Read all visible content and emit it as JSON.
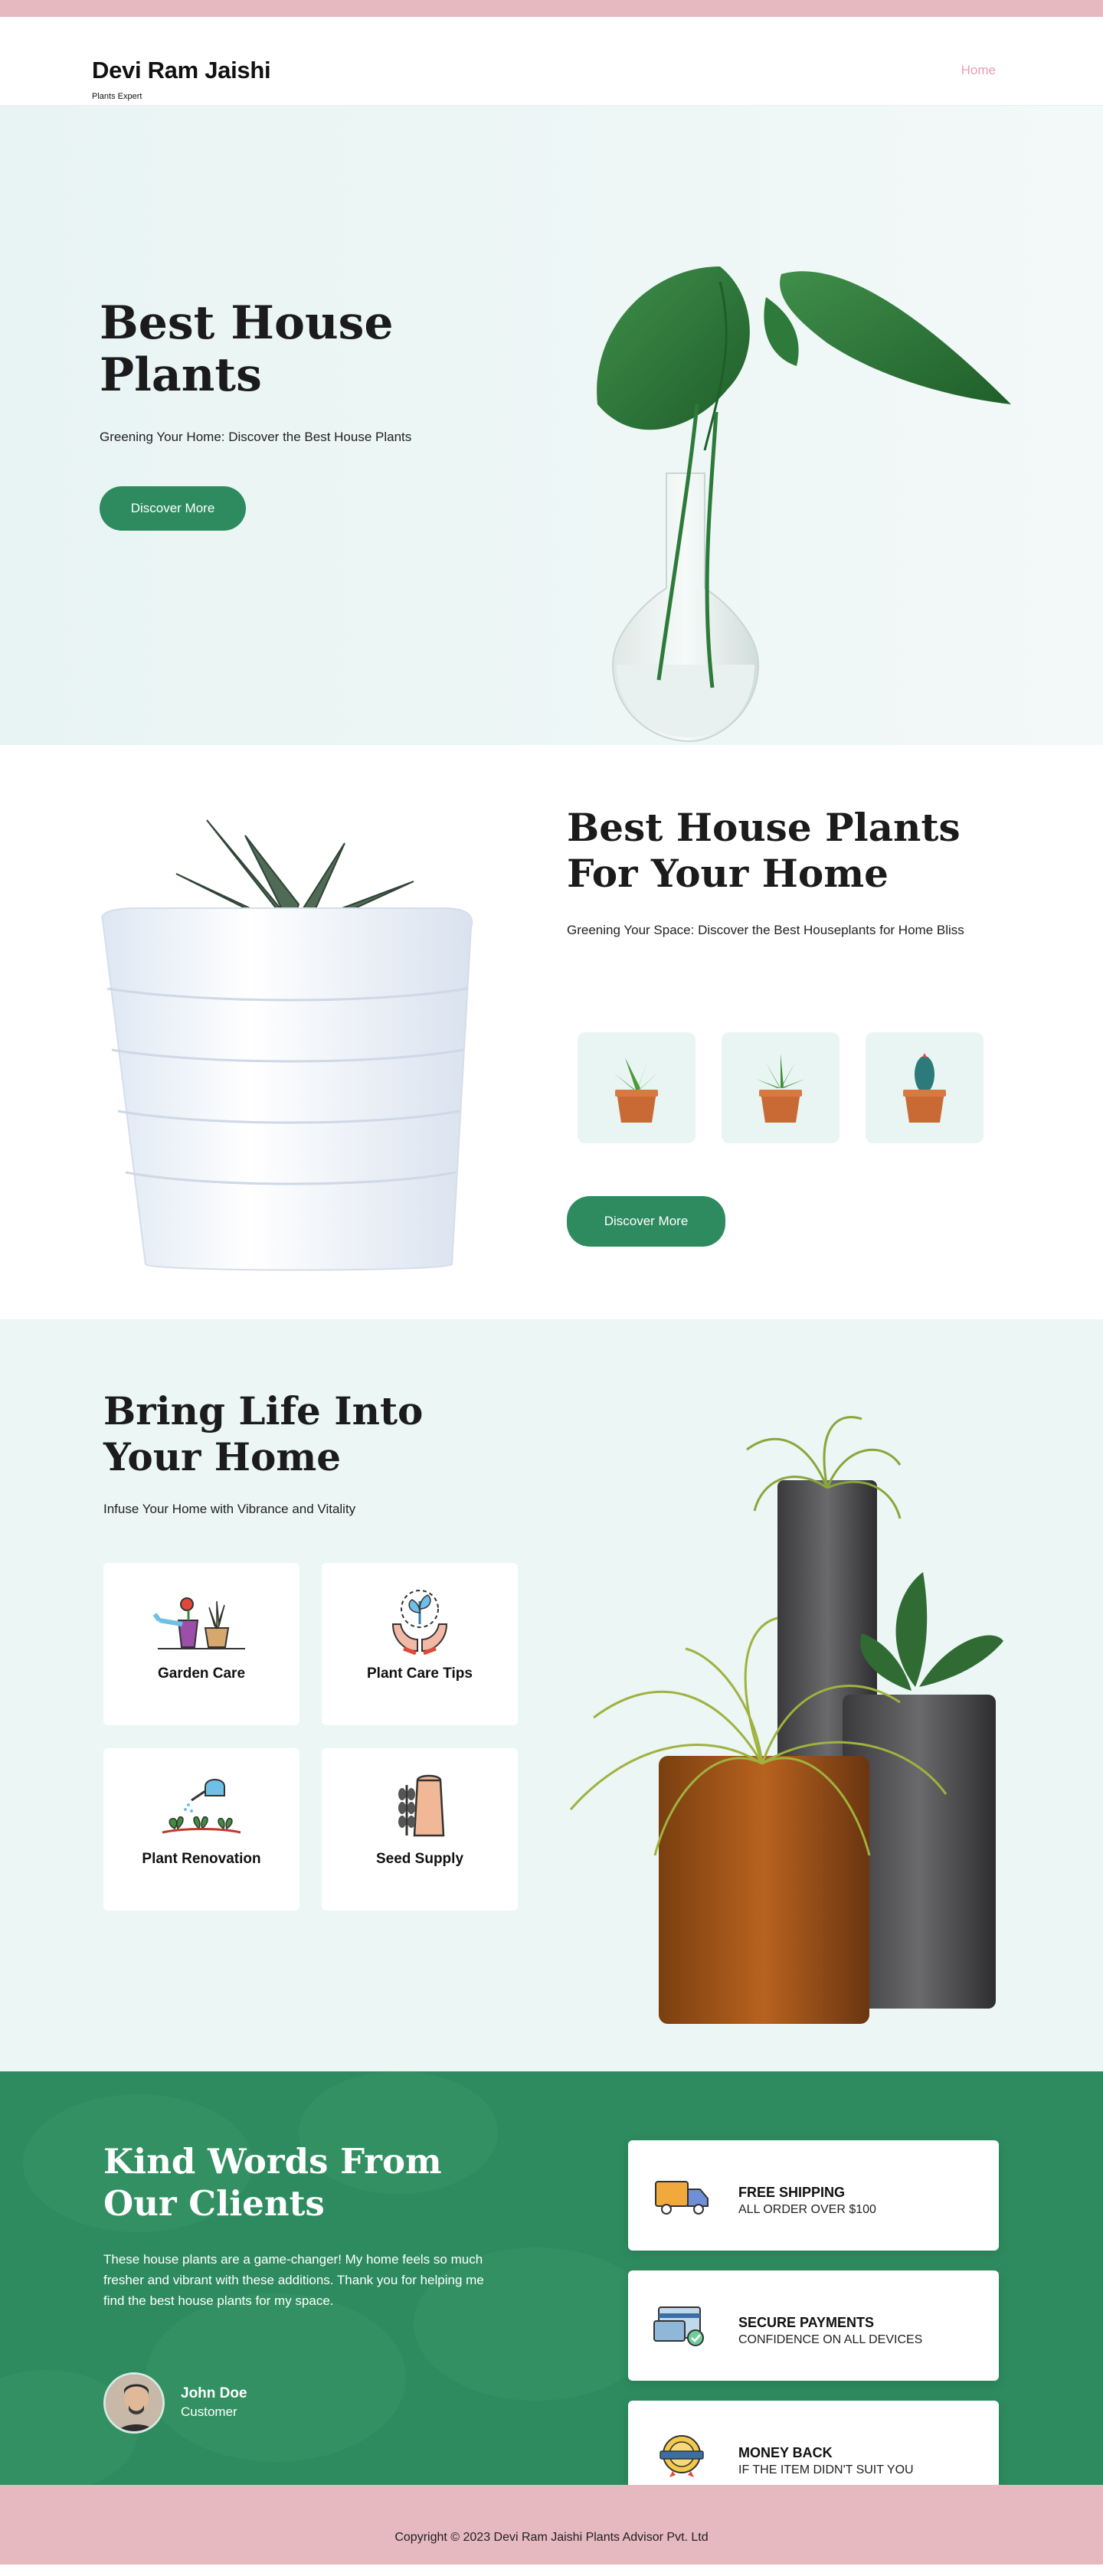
{
  "header": {
    "brand_name": "Devi Ram Jaishi",
    "brand_tagline": "Plants Expert",
    "nav_home": "Home"
  },
  "hero": {
    "title": "Best House Plants",
    "subtitle": "Greening Your Home: Discover the Best House Plants",
    "button_label": "Discover More"
  },
  "featured": {
    "title": "Best House Plants For Your Home",
    "subtitle": "Greening Your Space: Discover the Best Houseplants for Home Bliss",
    "button_label": "Discover More",
    "thumbnails": [
      "succulent-thumb",
      "aloe-thumb",
      "cactus-thumb"
    ]
  },
  "services": {
    "title": "Bring Life Into Your Home",
    "subtitle": "Infuse Your Home with Vibrance and Vitality",
    "items": [
      {
        "label": "Garden Care",
        "icon": "garden-care-icon"
      },
      {
        "label": "Plant Care Tips",
        "icon": "plant-care-icon"
      },
      {
        "label": "Plant Renovation",
        "icon": "watering-can-icon"
      },
      {
        "label": "Seed Supply",
        "icon": "seed-bag-icon"
      }
    ]
  },
  "testimonial": {
    "title": "Kind Words From Our Clients",
    "quote": "These house plants are a game-changer! My home feels so much fresher and vibrant with these additions. Thank you for helping me find the best house plants for my space.",
    "name": "John Doe",
    "role": "Customer"
  },
  "features": [
    {
      "title": "FREE SHIPPING",
      "desc": "ALL ORDER OVER $100",
      "icon": "truck-icon"
    },
    {
      "title": "SECURE PAYMENTS",
      "desc": "CONFIDENCE ON ALL DEVICES",
      "icon": "card-icon"
    },
    {
      "title": "MONEY BACK",
      "desc": "IF THE ITEM DIDN'T SUIT YOU",
      "icon": "badge-icon"
    }
  ],
  "footer": {
    "copyright": "Copyright © 2023 Devi Ram Jaishi Plants Advisor Pvt. Ltd"
  },
  "colors": {
    "accent": "#2e8b5f",
    "pink": "#e6b8c0",
    "mint": "#ebf6f5"
  }
}
